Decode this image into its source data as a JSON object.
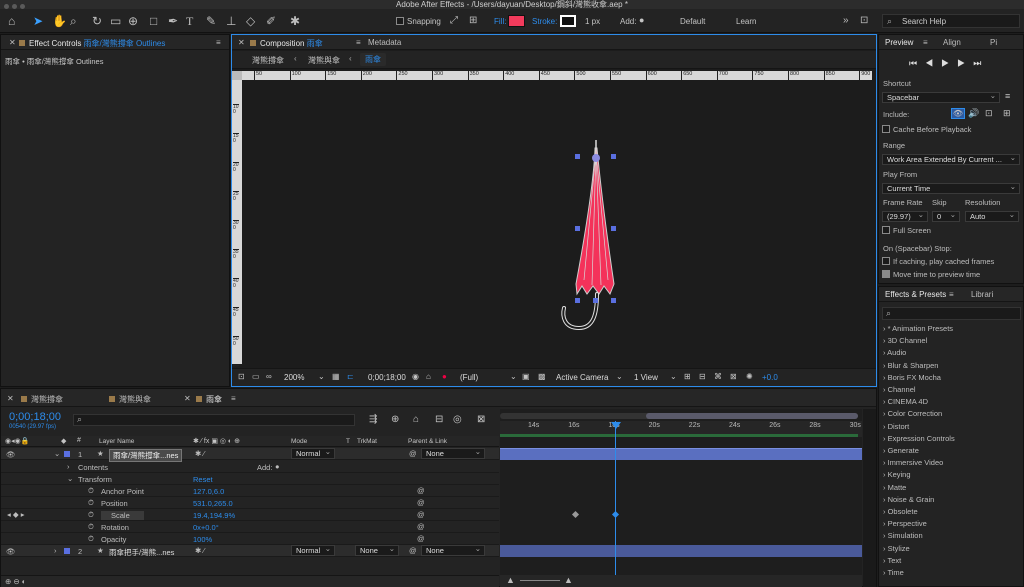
{
  "window": {
    "title": "Adobe After Effects - /Users/dayuan/Desktop/鋼斜/灣熊收傘.aep *"
  },
  "toolbar": {
    "snapping_label": "Snapping",
    "fill_label": "Fill:",
    "fill_color": "#f23b5c",
    "stroke_label": "Stroke:",
    "stroke_width": "1 px",
    "add_label": "Add:",
    "workspace_default": "Default",
    "workspace_learn": "Learn",
    "search_help": "Search Help"
  },
  "effect_controls": {
    "tab_label": "Effect Controls",
    "tab_layer": "雨傘/灣熊撐傘 Outlines",
    "header": "雨傘 • 雨傘/灣熊撐傘 Outlines"
  },
  "composition": {
    "tab_label": "Composition",
    "tab_name": "雨傘",
    "metadata_tab": "Metadata",
    "breadcrumbs": [
      "灣熊撐傘",
      "灣熊與傘",
      "雨傘"
    ],
    "ruler_labels": [
      "50",
      "100",
      "150",
      "200",
      "250",
      "300",
      "350",
      "400",
      "450",
      "500",
      "550",
      "600",
      "650",
      "700",
      "750",
      "800",
      "850",
      "900"
    ],
    "vruler_labels": [
      "100",
      "150",
      "200",
      "250",
      "300",
      "350",
      "400",
      "450",
      "500",
      "550"
    ],
    "zoom": "200%",
    "timecode": "0;00;18;00",
    "resolution": "(Full)",
    "camera": "Active Camera",
    "views": "1 View",
    "exposure": "+0.0",
    "umbrella_color": "#f4325a"
  },
  "preview": {
    "tab_preview": "Preview",
    "tab_align": "Align",
    "tab_more": "Pi",
    "shortcut_label": "Shortcut",
    "shortcut_value": "Spacebar",
    "include_label": "Include:",
    "cache_label": "Cache Before Playback",
    "range_label": "Range",
    "range_value": "Work Area Extended By Current ...",
    "play_from_label": "Play From",
    "play_from_value": "Current Time",
    "frame_rate_label": "Frame Rate",
    "skip_label": "Skip",
    "resolution_label": "Resolution",
    "frame_rate_value": "(29.97)",
    "skip_value": "0",
    "resolution_value": "Auto",
    "full_screen_label": "Full Screen",
    "stop_label": "On (Spacebar) Stop:",
    "if_caching_label": "If caching, play cached frames",
    "move_time_label": "Move time to preview time"
  },
  "effects_presets": {
    "tab_label": "Effects & Presets",
    "tab_libraries": "Librari",
    "items": [
      "* Animation Presets",
      "3D Channel",
      "Audio",
      "Blur & Sharpen",
      "Boris FX Mocha",
      "Channel",
      "CINEMA 4D",
      "Color Correction",
      "Distort",
      "Expression Controls",
      "Generate",
      "Immersive Video",
      "Keying",
      "Matte",
      "Noise & Grain",
      "Obsolete",
      "Perspective",
      "Simulation",
      "Stylize",
      "Text",
      "Time"
    ]
  },
  "timeline": {
    "tabs": [
      "灣熊撐傘",
      "灣熊與傘",
      "雨傘"
    ],
    "timecode": "0;00;18;00",
    "frame_info": "00540 (29.97 fps)",
    "col_layer_name": "Layer Name",
    "col_mode": "Mode",
    "col_t": "T",
    "col_trkmat": "TrkMat",
    "col_parent": "Parent & Link",
    "time_labels": [
      "14s",
      "16s",
      "18s",
      "20s",
      "22s",
      "24s",
      "26s",
      "28s",
      "30s"
    ],
    "layers": [
      {
        "num": "1",
        "name": "雨傘/灣熊撐傘...nes",
        "mode": "Normal",
        "parent": "None"
      },
      {
        "num": "2",
        "name": "雨傘把手/灣熊...nes",
        "mode": "Normal",
        "trkmat": "None",
        "parent": "None"
      }
    ],
    "contents_label": "Contents",
    "add_label": "Add:",
    "transform_label": "Transform",
    "reset_label": "Reset",
    "properties": [
      {
        "name": "Anchor Point",
        "value": "127.0,6.0"
      },
      {
        "name": "Position",
        "value": "531.0,265.0"
      },
      {
        "name": "Scale",
        "value": "19.4,194.9%"
      },
      {
        "name": "Rotation",
        "value": "0x+0.0°"
      },
      {
        "name": "Opacity",
        "value": "100%"
      }
    ]
  }
}
